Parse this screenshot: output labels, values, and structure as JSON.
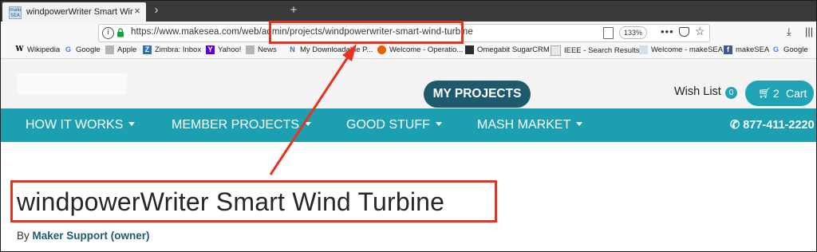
{
  "browser": {
    "tab": {
      "favicon_text": "make SEA",
      "title": "windpowerWriter Smart Wind T"
    },
    "new_tab_symbol": "+",
    "url": "https://www.makesea.com/web/admin/projects/windpowerwriter-smart-wind-turbine",
    "zoom": "133%",
    "bookmarks": [
      {
        "label": "Wikipedia",
        "icon": "wikipedia-icon",
        "icon_text": "W"
      },
      {
        "label": "Google",
        "icon": "google-icon",
        "icon_text": "G"
      },
      {
        "label": "Apple",
        "icon": "folder-icon",
        "icon_text": ""
      },
      {
        "label": "Zimbra: Inbox",
        "icon": "zimbra-icon",
        "icon_text": "Z"
      },
      {
        "label": "Yahoo!",
        "icon": "yahoo-icon",
        "icon_text": "Y"
      },
      {
        "label": "News",
        "icon": "folder-icon",
        "icon_text": ""
      },
      {
        "label": "My Downloadable P...",
        "icon": "download-icon",
        "icon_text": "N"
      },
      {
        "label": "Welcome - Operatio...",
        "icon": "firefox-icon",
        "icon_text": ""
      },
      {
        "label": "Omegabit SugarCRM",
        "icon": "omegabit-icon",
        "icon_text": ""
      },
      {
        "label": "IEEE - Search Results",
        "icon": "ieee-icon",
        "icon_text": ""
      },
      {
        "label": "Welcome - makeSEA",
        "icon": "makesea-icon",
        "icon_text": ""
      },
      {
        "label": "makeSEA",
        "icon": "facebook-icon",
        "icon_text": "f"
      },
      {
        "label": "Google",
        "icon": "google-icon",
        "icon_text": "G"
      }
    ]
  },
  "site": {
    "my_projects": "MY PROJECTS",
    "wish_list": "Wish List",
    "wish_count": "0",
    "cart_count": "2",
    "cart_label": "Cart",
    "nav": [
      {
        "label": "HOW IT WORKS"
      },
      {
        "label": "MEMBER PROJECTS"
      },
      {
        "label": "GOOD STUFF"
      },
      {
        "label": "MASH MARKET"
      }
    ],
    "phone": "877-411-2220",
    "page_title": "windpowerWriter Smart Wind Turbine",
    "by_prefix": "By",
    "owner": "Maker Support (owner)"
  },
  "colors": {
    "accent": "#1c9fb0",
    "dark_teal": "#1d5a6e",
    "annotation": "#e8321e"
  }
}
